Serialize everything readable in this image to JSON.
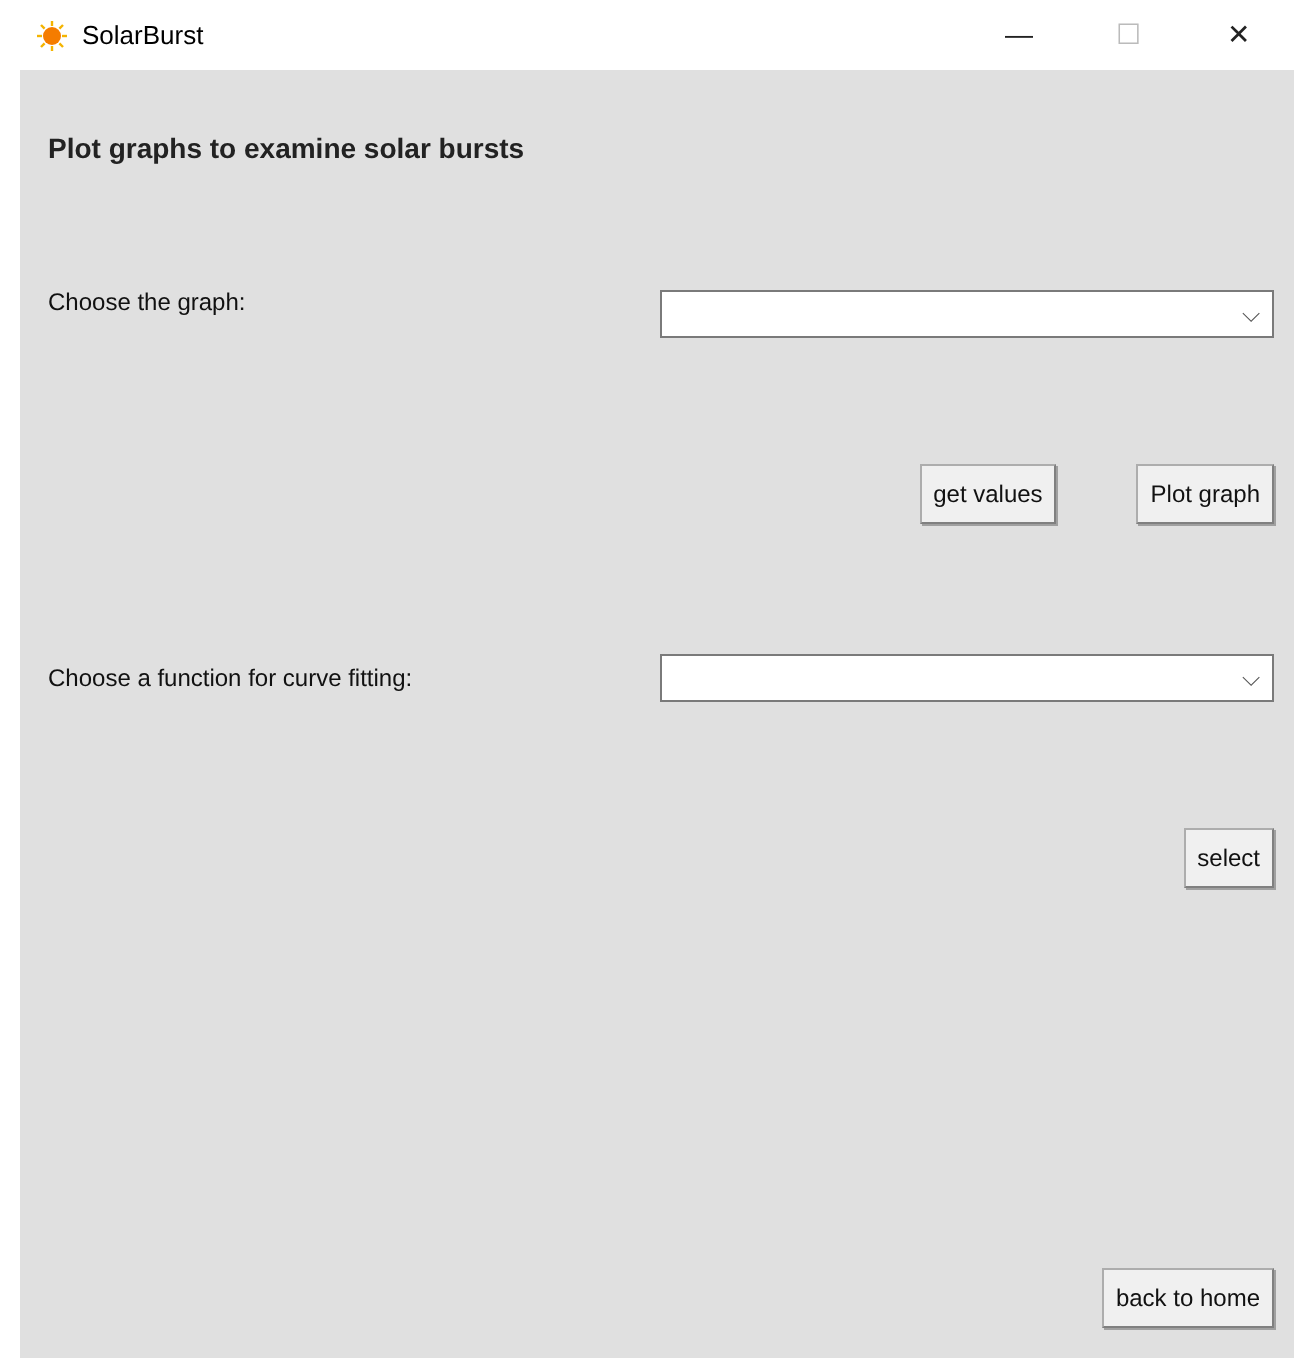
{
  "window": {
    "title": "SolarBurst",
    "controls": [
      "—",
      "☐",
      "✕"
    ]
  },
  "heading": "Plot graphs to examine solar bursts",
  "graph_row": {
    "label": "Choose the graph:",
    "combobox": {
      "arrow": "⌵"
    }
  },
  "graph_buttons": [
    "get values",
    "Plot graph"
  ],
  "fit_row": {
    "label": "Choose a function for curve fitting:",
    "combobox": {
      "arrow": "⌵"
    }
  },
  "fit_buttons": [
    "select"
  ],
  "footer_buttons": [
    "back to home"
  ]
}
